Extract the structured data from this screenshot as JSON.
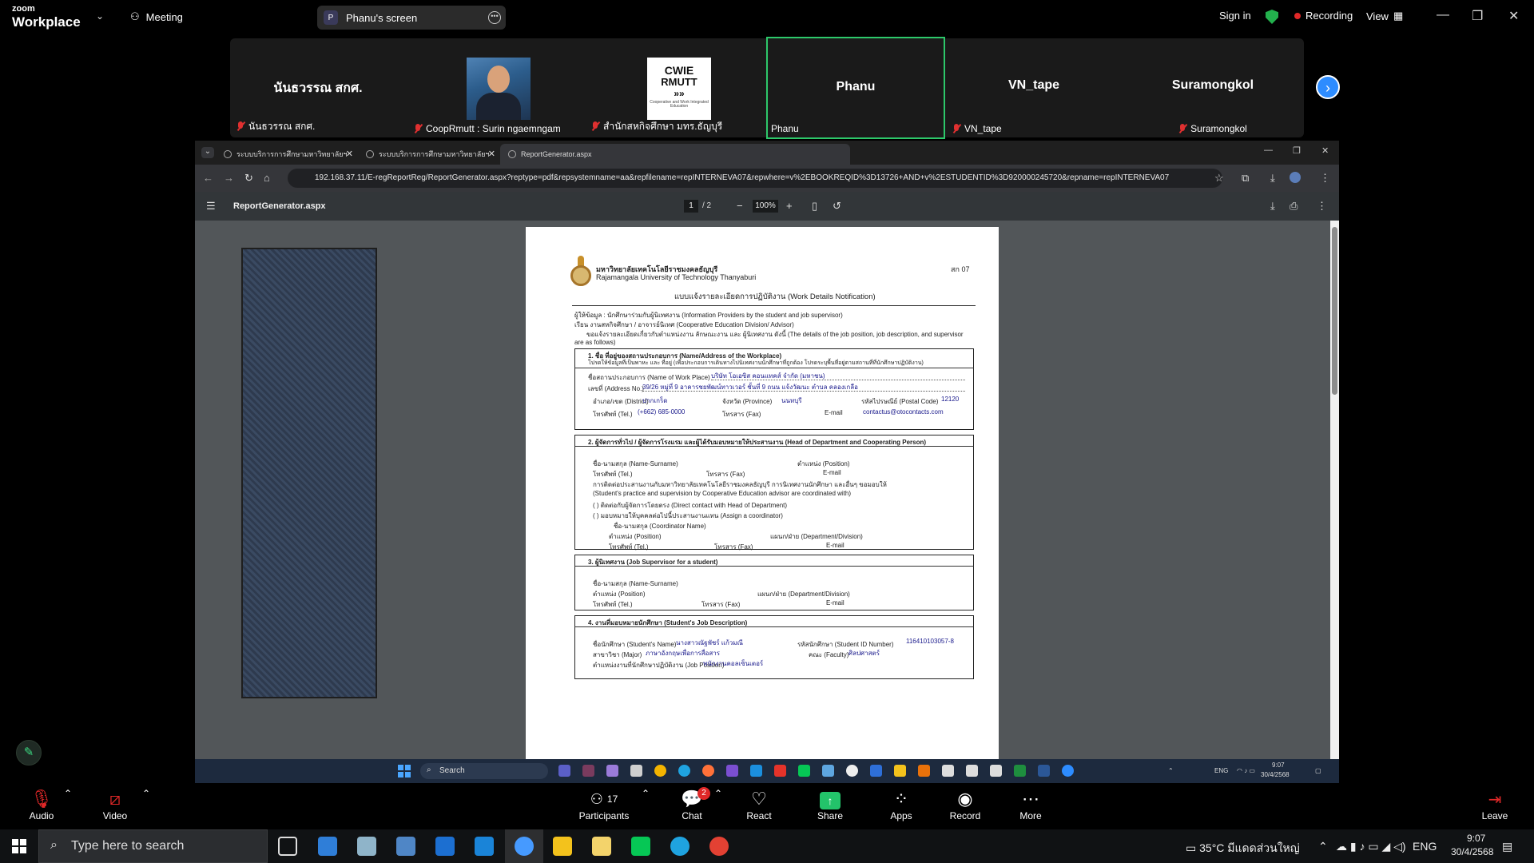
{
  "zoom": {
    "brand_top": "zoom",
    "brand_bottom": "Workplace",
    "meeting_label": "Meeting",
    "screen_label": "Phanu's screen",
    "screen_initial": "P",
    "sign_in": "Sign in",
    "recording": "Recording",
    "view": "View"
  },
  "gallery": [
    {
      "name": "นันธวรรณ สกศ.",
      "label": "นันธวรรณ สกศ.",
      "muted": true
    },
    {
      "name": "",
      "label": "CoopRmutt : Surin ngaemngam",
      "muted": true,
      "image": "photo"
    },
    {
      "name": "",
      "label": "สำนักสหกิจศึกษา มทร.ธัญบุรี",
      "muted": true,
      "image": "logo"
    },
    {
      "name": "Phanu",
      "label": "Phanu",
      "muted": false,
      "active": true
    },
    {
      "name": "VN_tape",
      "label": "VN_tape",
      "muted": true
    },
    {
      "name": "Suramongkol",
      "label": "Suramongkol",
      "muted": true
    }
  ],
  "cwie_logo": {
    "line1": "CWIE",
    "line2": "RMUTT",
    "line3": "»»",
    "line4": "Cooperative and Work Integrated Education"
  },
  "browser": {
    "tabs": [
      "ระบบบริการการศึกษามหาวิทยาลัยฯ",
      "ระบบบริการการศึกษามหาวิทยาลัยฯ",
      "ReportGenerator.aspx"
    ],
    "url": "192.168.37.11/E-regReportReg/ReportGenerator.aspx?reptype=pdf&repsystemname=aa&repfilename=repINTERNEVA07&repwhere=v%2EBOOKREQID%3D13726+AND+v%2ESTUDENTID%3D920000245720&repname=repINTERNEVA07",
    "pdf_title": "ReportGenerator.aspx",
    "page_current": "1",
    "page_total": "/ 2",
    "zoom": "100%"
  },
  "doc": {
    "univ_th": "มหาวิทยาลัยเทคโนโลยีราชมงคลธัญบุรี",
    "univ_en": "Rajamangala University of Technology Thanyaburi",
    "code": "สก 07",
    "form_title": "แบบแจ้งรายละเอียดการปฏิบัติงาน (Work Details Notification)",
    "intro1": "ผู้ให้ข้อมูล : นักศึกษาร่วมกับผู้นิเทศงาน (Information Providers by the student and job supervisor)",
    "intro2": "เรียน งานสหกิจศึกษา / อาจารย์นิเทศ (Cooperative Education Division/ Advisor)",
    "intro3": "ขอแจ้งรายละเอียดเกี่ยวกับตำแหน่งงาน ลักษณะงาน และ ผู้นิเทศงาน ดังนี้ (The details of the job position, job description, and supervisor",
    "intro4": "are as follows)",
    "s1_title": "1. ชื่อ ที่อยู่ของสถานประกอบการ (Name/Address of the Workplace)",
    "s1_sub": "โปรดให้ข้อมูลที่เป็นพาหะ และ ที่อยู่ (เพื่อประกอบการเดินทางไปนิเทศงานนักศึกษาที่ถูกต้อง โปรดระบุพื้นที่อยู่ตามสถานที่ที่นักศึกษาปฏิบัติงาน)",
    "s1_l1": "ชื่อสถานประกอบการ (Name of Work Place)",
    "s1_v1": "บริษัท โอเอซิส คอนแทคส์ จำกัด (มหาชน)",
    "s1_l2": "เลขที่ (Address No.)",
    "s1_v2": "39/26 หมู่ที่ 9 อาคารชยพัฒน์ทาวเวอร์ ชั้นที่ 9 ถนน แจ้งวัฒนะ ตำบล คลองเกลือ",
    "s1_l3": "อำเภอ/เขต (District)",
    "s1_v3": "ปากเกร็ด",
    "s1_l3b": "จังหวัด (Province)",
    "s1_v3b": "นนทบุรี",
    "s1_l3c": "รหัสไปรษณีย์ (Postal Code)",
    "s1_v3c": "12120",
    "s1_l4": "โทรศัพท์ (Tel.)",
    "s1_v4": "(+662) 685-0000",
    "s1_l4b": "โทรสาร (Fax)",
    "s1_l4c": "E-mail",
    "s1_v4c": "contactus@otocontacts.com",
    "s2_title": "2. ผู้จัดการทั่วไป / ผู้จัดการโรงแรม และผู้ได้รับมอบหมายให้ประสานงาน (Head of Department and Cooperating Person)",
    "s2_l1": "ชื่อ-นามสกุล (Name-Surname)",
    "s2_l1b": "ตำแหน่ง (Position)",
    "s2_l2": "โทรศัพท์ (Tel.)",
    "s2_l2b": "โทรสาร (Fax)",
    "s2_l2c": "E-mail",
    "s2_t1": "การติดต่อประสานงานกับมหาวิทยาลัยเทคโนโลยีราชมงคลธัญบุรี การนิเทศงานนักศึกษา และอื่นๆ ขอมอบให้",
    "s2_t2": "(Student's practice and supervision by Cooperative Education advisor are coordinated with)",
    "s2_o1": "(    ) ติดต่อกับผู้จัดการโดยตรง (Direct contact with Head of Department)",
    "s2_o2": "(    ) มอบหมายให้บุคคลต่อไปนี้ประสานงานแทน (Assign a coordinator)",
    "s2_c1": "ชื่อ-นามสกุล (Coordinator Name)",
    "s2_c2": "ตำแหน่ง (Position)",
    "s2_c2b": "แผนก/ฝ่าย (Department/Division)",
    "s2_c3": "โทรศัพท์ (Tel.)",
    "s2_c3b": "โทรสาร (Fax)",
    "s2_c3c": "E-mail",
    "s3_title": "3. ผู้นิเทศงาน (Job Supervisor for a student)",
    "s3_l1": "ชื่อ-นามสกุล (Name-Surname)",
    "s3_l2": "ตำแหน่ง (Position)",
    "s3_l2b": "แผนก/ฝ่าย (Department/Division)",
    "s3_l3": "โทรศัพท์ (Tel.)",
    "s3_l3b": "โทรสาร (Fax)",
    "s3_l3c": "E-mail",
    "s4_title": "4. งานที่มอบหมายนักศึกษา (Student's Job Description)",
    "s4_l1": "ชื่อนักศึกษา (Student's Name)",
    "s4_v1": "นางสาวณัฐพัชร์ แก้วมณี",
    "s4_l1b": "รหัสนักศึกษา (Student ID Number)",
    "s4_v1b": "116410103057-8",
    "s4_l2": "สาขาวิชา (Major)",
    "s4_v2": "ภาษาอังกฤษเพื่อการสื่อสาร",
    "s4_l2b": "คณะ (Faculty)",
    "s4_v2b": "ศิลปศาสตร์",
    "s4_l3": "ตำแหน่งงานที่นักศึกษาปฏิบัติงาน (Job Position)",
    "s4_v3": "พนักงานคอลเซ็นเตอร์"
  },
  "shared_taskbar": {
    "search": "Search",
    "lang": "ENG",
    "time": "9:07",
    "date": "30/4/2568"
  },
  "controls": {
    "audio": "Audio",
    "video": "Video",
    "participants": "Participants",
    "participants_count": "17",
    "chat": "Chat",
    "chat_badge": "2",
    "react": "React",
    "share": "Share",
    "apps": "Apps",
    "record": "Record",
    "more": "More",
    "leave": "Leave"
  },
  "taskbar": {
    "search_placeholder": "Type here to search",
    "weather": "35°C มีแดดส่วนใหญ่",
    "lang": "ENG",
    "time": "9:07",
    "date": "30/4/2568"
  }
}
